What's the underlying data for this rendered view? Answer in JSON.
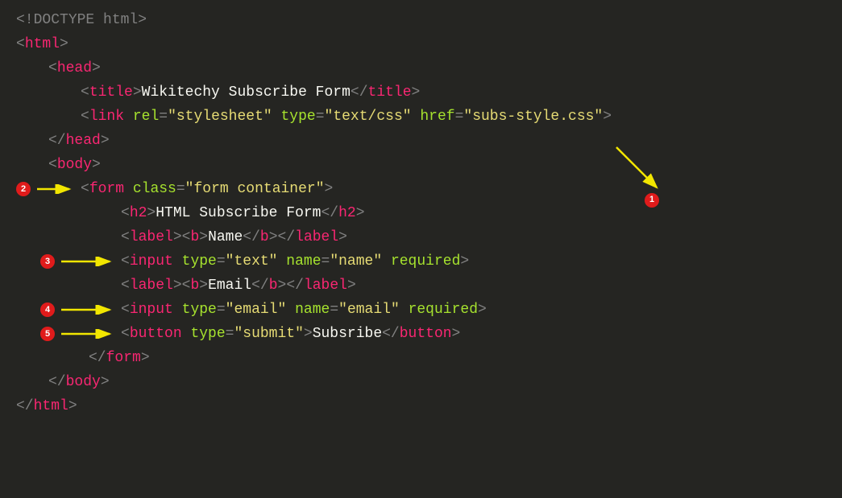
{
  "colors": {
    "bg": "#252522",
    "punct": "#808080",
    "tag": "#f92672",
    "attr": "#a6e22e",
    "str": "#e6db74",
    "text": "#f8f8f2",
    "marker_bg": "#e01b1b",
    "marker_fg": "#ffffff",
    "arrow": "#f2e600"
  },
  "markers": {
    "m1": "1",
    "m2": "2",
    "m3": "3",
    "m4": "4",
    "m5": "5"
  },
  "code": {
    "l1_lt": "<!",
    "l1_doctype": "DOCTYPE html",
    "l1_gt": ">",
    "l2_lt": "<",
    "l2_tag": "html",
    "l2_gt": ">",
    "l3_lt": "<",
    "l3_tag": "head",
    "l3_gt": ">",
    "l4_lt": "<",
    "l4_tag": "title",
    "l4_gt": ">",
    "l4_text": "Wikitechy Subscribe Form",
    "l4_clt": "</",
    "l4_ctag": "title",
    "l4_cgt": ">",
    "l5_lt": "<",
    "l5_tag": "link",
    "l5_a1": "rel",
    "l5_eq1": "=",
    "l5_v1": "\"stylesheet\"",
    "l5_a2": "type",
    "l5_eq2": "=",
    "l5_v2": "\"text/css\"",
    "l5_a3": "href",
    "l5_eq3": "=",
    "l5_v3": "\"subs-style.css\"",
    "l5_gt": ">",
    "l6_lt": "</",
    "l6_tag": "head",
    "l6_gt": ">",
    "l7_lt": "<",
    "l7_tag": "body",
    "l7_gt": ">",
    "l8_lt": "<",
    "l8_tag": "form",
    "l8_a1": "class",
    "l8_eq1": "=",
    "l8_v1": "\"form container\"",
    "l8_gt": ">",
    "l9_lt": "<",
    "l9_tag": "h2",
    "l9_gt": ">",
    "l9_text": "HTML Subscribe Form",
    "l9_clt": "</",
    "l9_ctag": "h2",
    "l9_cgt": ">",
    "l10_lt": "<",
    "l10_tag": "label",
    "l10_gt": ">",
    "l10_blt": "<",
    "l10_btag": "b",
    "l10_bgt": ">",
    "l10_btext": "Name",
    "l10_bclt": "</",
    "l10_bctag": "b",
    "l10_bcgt": ">",
    "l10_clt": "</",
    "l10_ctag": "label",
    "l10_cgt": ">",
    "l11_lt": "<",
    "l11_tag": "input",
    "l11_a1": "type",
    "l11_eq1": "=",
    "l11_v1": "\"text\"",
    "l11_a2": "name",
    "l11_eq2": "=",
    "l11_v2": "\"name\"",
    "l11_a3": "required",
    "l11_gt": ">",
    "l12_lt": "<",
    "l12_tag": "label",
    "l12_gt": ">",
    "l12_blt": "<",
    "l12_btag": "b",
    "l12_bgt": ">",
    "l12_btext": "Email",
    "l12_bclt": "</",
    "l12_bctag": "b",
    "l12_bcgt": ">",
    "l12_clt": "</",
    "l12_ctag": "label",
    "l12_cgt": ">",
    "l13_lt": "<",
    "l13_tag": "input",
    "l13_a1": "type",
    "l13_eq1": "=",
    "l13_v1": "\"email\"",
    "l13_a2": "name",
    "l13_eq2": "=",
    "l13_v2": "\"email\"",
    "l13_a3": "required",
    "l13_gt": ">",
    "l14_lt": "<",
    "l14_tag": "button",
    "l14_a1": "type",
    "l14_eq1": "=",
    "l14_v1": "\"submit\"",
    "l14_gt": ">",
    "l14_text": "Subsribe",
    "l14_clt": "</",
    "l14_ctag": "button",
    "l14_cgt": ">",
    "l15_lt": "</",
    "l15_tag": "form",
    "l15_gt": ">",
    "l16_lt": "</",
    "l16_tag": "body",
    "l16_gt": ">",
    "l17_lt": "</",
    "l17_tag": "html",
    "l17_gt": ">"
  }
}
